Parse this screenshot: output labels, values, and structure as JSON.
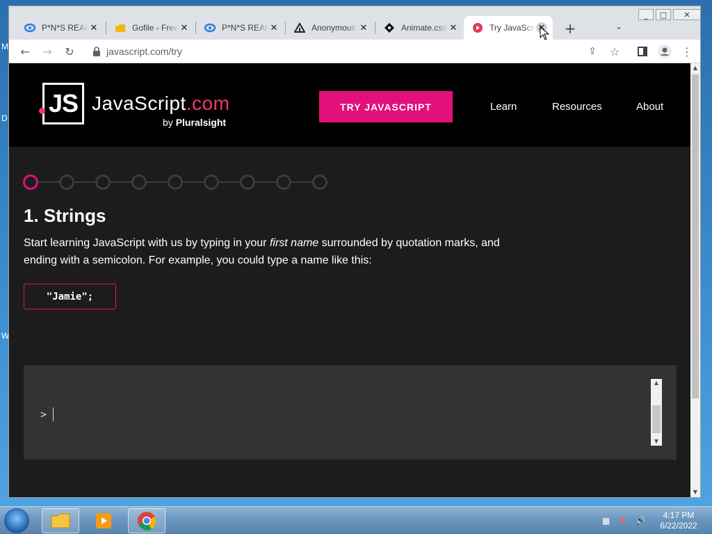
{
  "browser": {
    "tabs": [
      {
        "title": "P*N*S REAL",
        "favicon": "blue-swirl-icon",
        "active": false
      },
      {
        "title": "Gofile - Free",
        "favicon": "folder-icon",
        "active": false
      },
      {
        "title": "P*N*S REAL",
        "favicon": "blue-swirl-icon",
        "active": false
      },
      {
        "title": "Anonymous",
        "favicon": "triangle-logo-icon",
        "active": false
      },
      {
        "title": "Animate.css",
        "favicon": "animate-logo-icon",
        "active": false
      },
      {
        "title": "Try JavaScript",
        "favicon": "red-play-icon",
        "active": true
      }
    ],
    "url": "javascript.com/try"
  },
  "site": {
    "logo_letters": "JS",
    "brand_main": "JavaScript",
    "brand_suffix": ".com",
    "byline_prefix": "by ",
    "byline_brand": "Pluralsight",
    "cta_label": "TRY JAVASCRIPT",
    "nav": [
      "Learn",
      "Resources",
      "About"
    ],
    "accent_color": "#e30f7a"
  },
  "lesson": {
    "step_count": 9,
    "active_step": 1,
    "title": "1. Strings",
    "text_before": "Start learning JavaScript with us by typing in your ",
    "text_em": "first name",
    "text_after": " surrounded by quotation marks, and ending with a semicolon. For example, you could type a name like this:",
    "example_code": "\"Jamie\";"
  },
  "console": {
    "prompt": ">",
    "input_value": ""
  },
  "taskbar": {
    "time": "4:17 PM",
    "date": "6/22/2022"
  }
}
